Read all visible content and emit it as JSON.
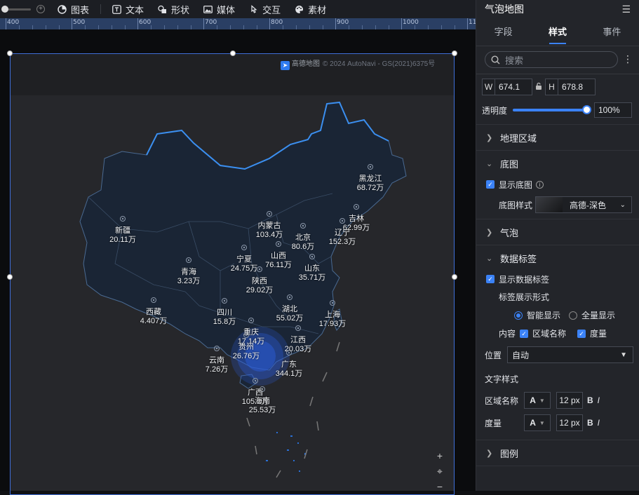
{
  "toolbar": {
    "items": [
      {
        "label": "图表",
        "icon": "pie-chart-icon"
      },
      {
        "label": "文本",
        "icon": "text-icon"
      },
      {
        "label": "形状",
        "icon": "shape-icon"
      },
      {
        "label": "媒体",
        "icon": "image-icon"
      },
      {
        "label": "交互",
        "icon": "interaction-icon"
      },
      {
        "label": "素材",
        "icon": "palette-icon"
      }
    ]
  },
  "ruler": {
    "labels": [
      "400",
      "500",
      "600",
      "700",
      "800",
      "900",
      "1000",
      "11"
    ]
  },
  "map": {
    "attribution_brand": "高德地图",
    "attribution": "© 2024 AutoNavi - GS(2021)6375号",
    "controls": {
      "zoom_in": "+",
      "locate": "⌖",
      "zoom_out": "−"
    },
    "provinces": [
      {
        "name": "黑龙江",
        "value": "68.72万"
      },
      {
        "name": "吉林",
        "value": "62.99万"
      },
      {
        "name": "辽宁",
        "value": "152.3万"
      },
      {
        "name": "内蒙古",
        "value": "103.4万"
      },
      {
        "name": "北京",
        "value": "80.6万"
      },
      {
        "name": "新疆",
        "value": "20.11万"
      },
      {
        "name": "宁夏",
        "value": "24.75万"
      },
      {
        "name": "山西",
        "value": "76.11万"
      },
      {
        "name": "山东",
        "value": "35.71万"
      },
      {
        "name": "青海",
        "value": "3.23万"
      },
      {
        "name": "陕西",
        "value": "29.02万"
      },
      {
        "name": "西藏",
        "value": "4.407万"
      },
      {
        "name": "四川",
        "value": "15.8万"
      },
      {
        "name": "湖北",
        "value": "55.02万"
      },
      {
        "name": "上海",
        "value": "17.93万"
      },
      {
        "name": "重庆",
        "value": "17.14万"
      },
      {
        "name": "贵州",
        "value": "26.76万"
      },
      {
        "name": "江西",
        "value": "20.03万"
      },
      {
        "name": "云南",
        "value": "7.26万"
      },
      {
        "name": "广东",
        "value": "344.1万"
      },
      {
        "name": "广西",
        "value": "105.2万"
      },
      {
        "name": "海南",
        "value": "25.53万"
      }
    ]
  },
  "panel": {
    "title": "气泡地图",
    "tabs": [
      "字段",
      "样式",
      "事件"
    ],
    "active_tab": "样式",
    "search_placeholder": "搜索",
    "width_label": "W",
    "width_value": "674.1",
    "height_label": "H",
    "height_value": "678.8",
    "opacity_label": "透明度",
    "opacity_value": "100%",
    "opacity_level": 1.0,
    "sections": {
      "geo": "地理区域",
      "basemap": "底图",
      "bubble": "气泡",
      "data_label": "数据标签",
      "legend": "图例"
    },
    "show_basemap": "显示底图",
    "basemap_style_label": "底图样式",
    "basemap_style_value": "高德-深色",
    "show_data_label": "显示数据标签",
    "label_display_mode": "标签展示形式",
    "smart_display": "智能显示",
    "full_display": "全量显示",
    "content_label": "内容",
    "region_name": "区域名称",
    "measure": "度量",
    "position_label": "位置",
    "position_value": "自动",
    "text_style": "文字样式",
    "region_name_style": "区域名称",
    "measure_style": "度量",
    "font_letter": "A",
    "font_size": "12 px",
    "bold": "B",
    "italic": "I"
  }
}
